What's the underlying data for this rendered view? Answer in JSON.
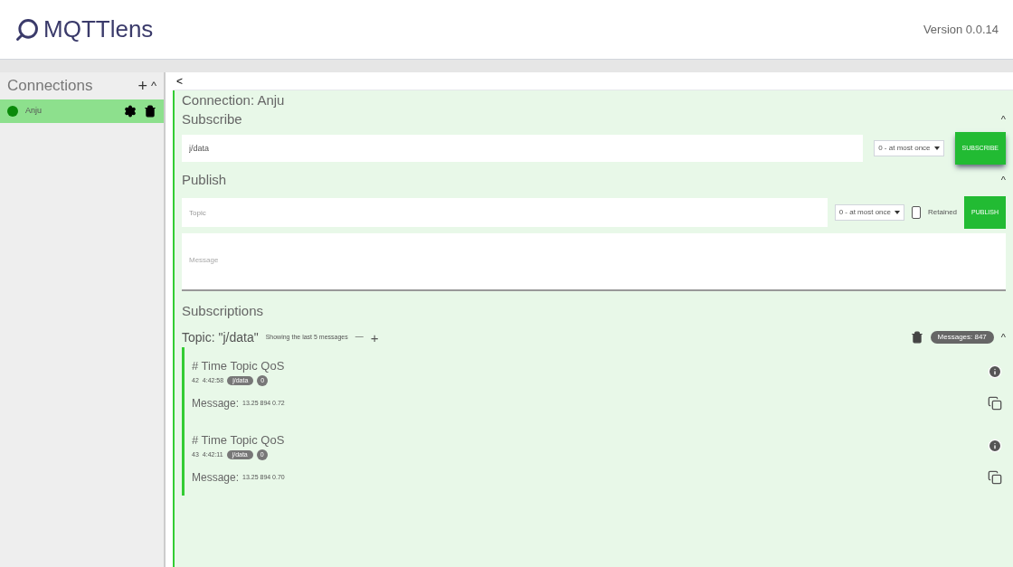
{
  "header": {
    "logo": "MQTTlens",
    "version": "Version 0.0.14"
  },
  "sidebar": {
    "title": "Connections",
    "add": "+",
    "collapse": "^",
    "connections": [
      {
        "name": "Anju",
        "selected": true,
        "color": "#0a8a0a"
      }
    ]
  },
  "panel": {
    "back": "<",
    "connection": "Connection: Anju",
    "subscribe": {
      "title": "Subscribe",
      "collapse": "^",
      "topic": "j/data",
      "qos": "0 - at most once",
      "button": "SUBSCRIBE"
    },
    "publish": {
      "title": "Publish",
      "collapse": "^",
      "topic_placeholder": "Topic",
      "qos": "0 - at most once",
      "retained": {
        "label": "Retained",
        "checked": false
      },
      "button": "PUBLISH",
      "message_placeholder": "Message"
    },
    "subscriptions": {
      "title": "Subscriptions",
      "topic": "Topic: \"j/data\"",
      "showing": "Showing the last 5 messages",
      "minus": "—",
      "plus": "+",
      "count": "Messages: 847",
      "collapse": "^",
      "messages": [
        {
          "header": "# Time Topic QoS",
          "number": "42",
          "time": "4:42:58",
          "topic": "j/data",
          "qos": "0",
          "label": "Message:",
          "payload": "13.25 894 0.72"
        },
        {
          "header": "# Time Topic QoS",
          "number": "43",
          "time": "4:42:11",
          "topic": "j/data",
          "qos": "0",
          "label": "Message:",
          "payload": "13.25 894 0.70"
        }
      ]
    }
  }
}
